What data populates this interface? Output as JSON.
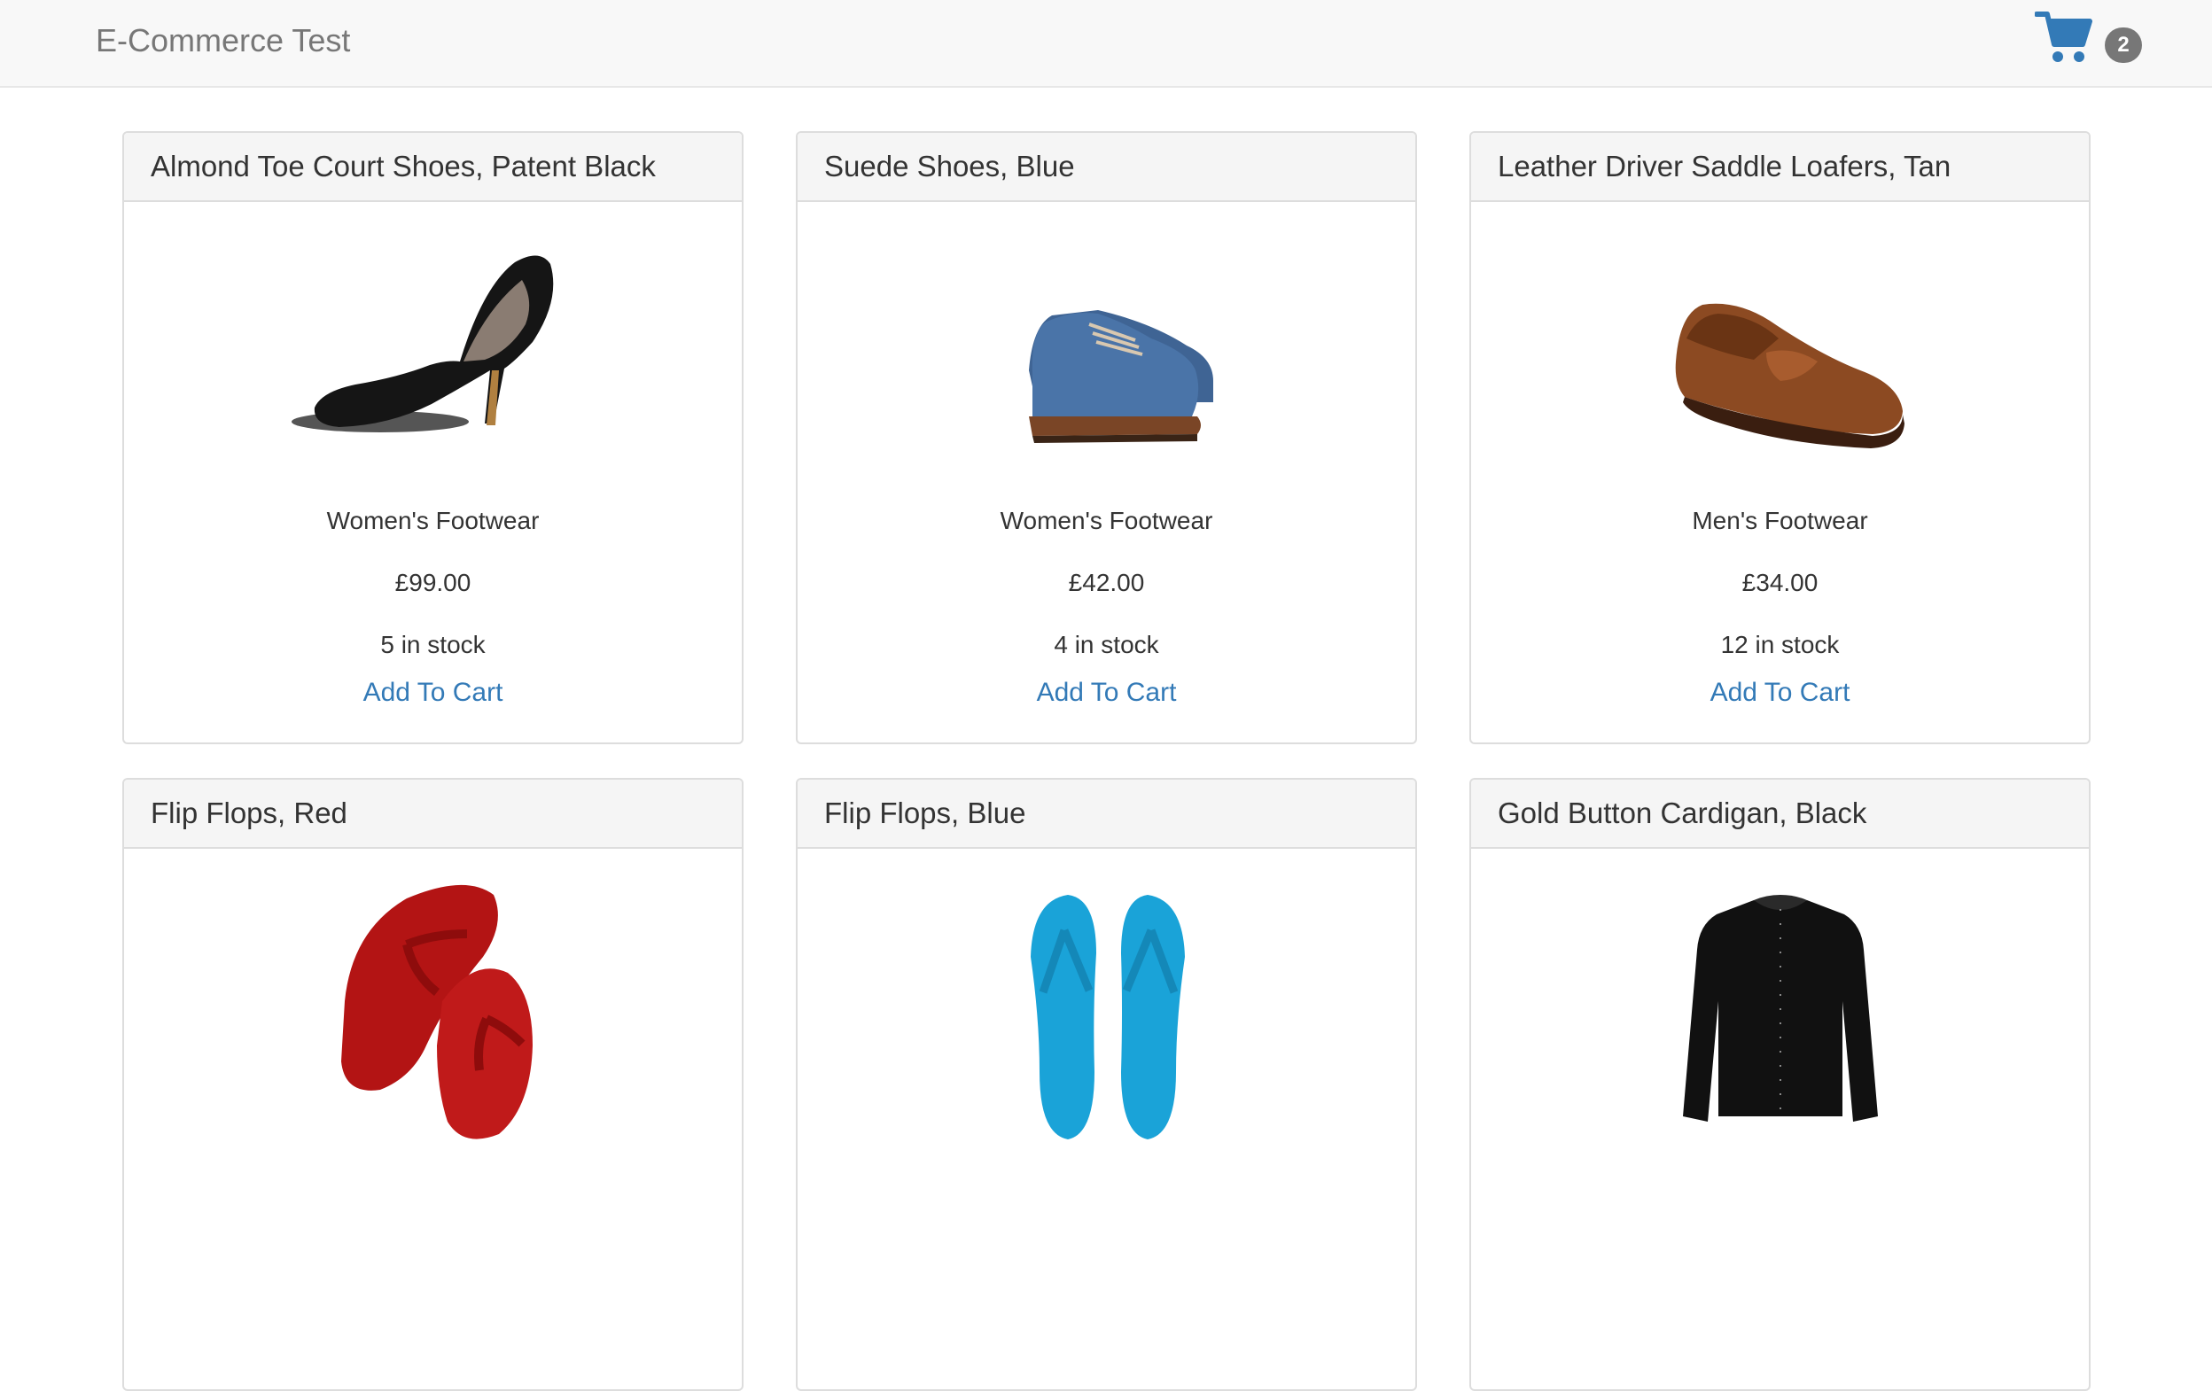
{
  "header": {
    "brand": "E-Commerce Test",
    "cart_icon": "shopping-cart-icon",
    "cart_count": "2"
  },
  "products": [
    {
      "name": "Almond Toe Court Shoes, Patent Black",
      "image": "black-court-shoe-image",
      "category": "Women's Footwear",
      "price": "£99.00",
      "stock": "5 in stock",
      "action": "Add To Cart"
    },
    {
      "name": "Suede Shoes, Blue",
      "image": "blue-suede-brogues-image",
      "category": "Women's Footwear",
      "price": "£42.00",
      "stock": "4 in stock",
      "action": "Add To Cart"
    },
    {
      "name": "Leather Driver Saddle Loafers, Tan",
      "image": "tan-loafer-image",
      "category": "Men's Footwear",
      "price": "£34.00",
      "stock": "12 in stock",
      "action": "Add To Cart"
    },
    {
      "name": "Flip Flops, Red",
      "image": "red-flip-flops-image"
    },
    {
      "name": "Flip Flops, Blue",
      "image": "blue-flip-flops-image"
    },
    {
      "name": "Gold Button Cardigan, Black",
      "image": "black-cardigan-image"
    }
  ],
  "colors": {
    "link": "#337ab7",
    "navbar_bg": "#f8f8f8",
    "panel_heading_bg": "#f5f5f5",
    "badge_bg": "#777777"
  }
}
